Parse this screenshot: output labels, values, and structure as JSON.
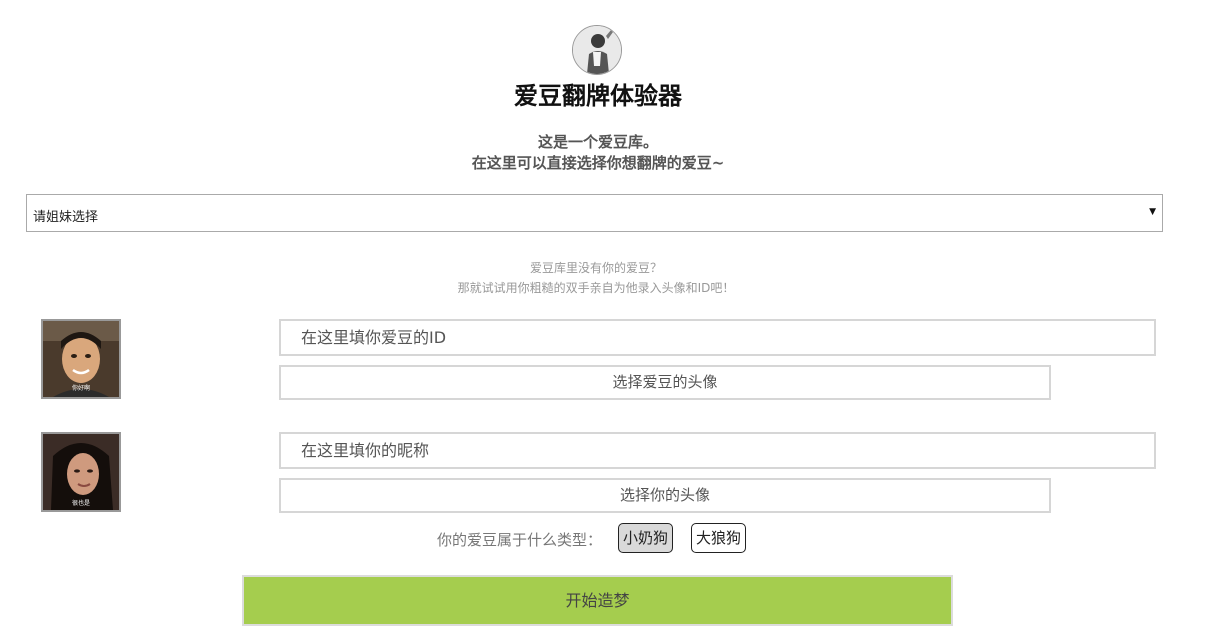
{
  "header": {
    "title": "爱豆翻牌体验器",
    "intro_line1": "这是一个爱豆库。",
    "intro_line2": "在这里可以直接选择你想翻牌的爱豆~"
  },
  "idol_select": {
    "selected_value": "请姐妹选择"
  },
  "hint": {
    "line1": "爱豆库里没有你的爱豆？",
    "line2": "那就试试用你粗糙的双手亲自为他录入头像和ID吧！"
  },
  "idol_entry": {
    "avatar_caption": "你好啊",
    "id_placeholder": "在这里填你爱豆的ID",
    "avatar_button": "选择爱豆的头像"
  },
  "user_entry": {
    "avatar_caption": "很也是",
    "nickname_placeholder": "在这里填你的昵称",
    "avatar_button": "选择你的头像"
  },
  "idol_type": {
    "label": "你的爱豆属于什么类型：",
    "options": [
      "小奶狗",
      "大狼狗"
    ],
    "selected_index": 0
  },
  "start_button": "开始造梦",
  "colors": {
    "start_button": "#a5cd4e",
    "selected_option": "#d9d9d9"
  }
}
